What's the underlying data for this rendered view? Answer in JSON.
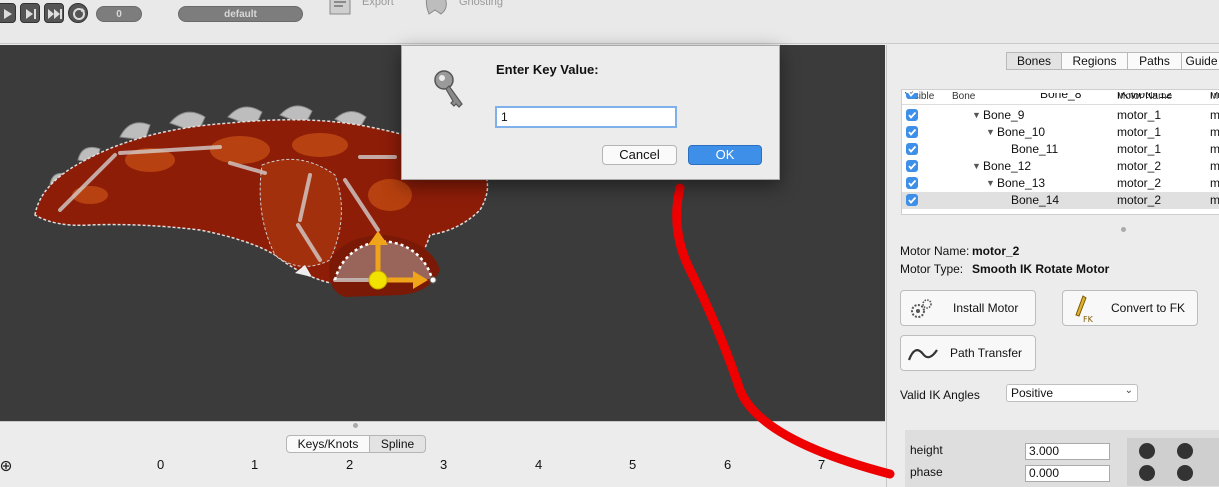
{
  "toolbar": {
    "frame_value": "0",
    "skin_value": "default",
    "export_label": "Export",
    "ghosting_label": "Ghosting"
  },
  "dialog": {
    "title": "Enter Key Value:",
    "input_value": "1",
    "cancel_label": "Cancel",
    "ok_label": "OK"
  },
  "panel": {
    "tabs": [
      "Bones",
      "Regions",
      "Paths",
      "Guide"
    ],
    "columns": {
      "visible": "Visible",
      "bone": "Bone",
      "motor_name": "Motor Name",
      "extra": "M"
    },
    "rows": [
      {
        "bone": "Bone_8",
        "motor": "IKMotor12",
        "extra": "m"
      },
      {
        "bone": "Bone_9",
        "motor": "motor_1",
        "extra": "m"
      },
      {
        "bone": "Bone_10",
        "motor": "motor_1",
        "extra": "m"
      },
      {
        "bone": "Bone_11",
        "motor": "motor_1",
        "extra": "m"
      },
      {
        "bone": "Bone_12",
        "motor": "motor_2",
        "extra": "m"
      },
      {
        "bone": "Bone_13",
        "motor": "motor_2",
        "extra": "m"
      },
      {
        "bone": "Bone_14",
        "motor": "motor_2",
        "extra": "m"
      }
    ],
    "motor_name_label": "Motor Name:",
    "motor_name_value": "motor_2",
    "motor_type_label": "Motor Type:",
    "motor_type_value": "Smooth IK Rotate Motor",
    "install_motor_label": "Install Motor",
    "convert_fk_label": "Convert to FK",
    "path_transfer_label": "Path Transfer",
    "ik_angles_label": "Valid IK Angles",
    "ik_angles_value": "Positive",
    "params": [
      {
        "name": "height",
        "value": "3.000"
      },
      {
        "name": "phase",
        "value": "0.000"
      }
    ]
  },
  "timeline": {
    "keys_knots_label": "Keys/Knots",
    "spline_label": "Spline",
    "ticks": [
      "0",
      "1",
      "2",
      "3",
      "4",
      "5",
      "6",
      "7"
    ]
  },
  "colors": {
    "accent_blue": "#3d8fe8",
    "canvas_bg": "#3b3b3b",
    "annotation_red": "#ee0000",
    "dino_red": "#8e1d08",
    "gizmo_yellow": "#f1e200",
    "gizmo_orange": "#f0a419"
  }
}
